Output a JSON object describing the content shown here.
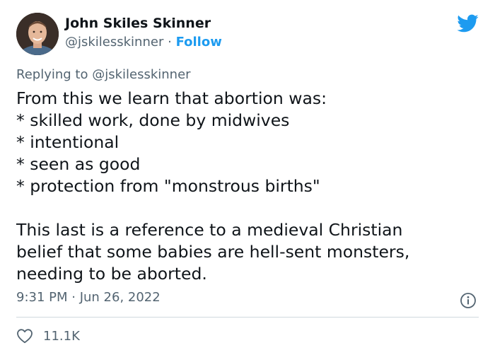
{
  "author": {
    "display_name": "John Skiles Skinner",
    "handle": "@jskilesskinner",
    "separator": "·",
    "follow_label": "Follow"
  },
  "reply": {
    "prefix": "Replying to",
    "handle": "@jskilesskinner"
  },
  "tweet": {
    "lines": [
      "From this we learn that abortion was:",
      "* skilled work, done by midwives",
      "* intentional",
      "* seen as good",
      "* protection from \"monstrous births\""
    ],
    "paragraph2": [
      "This last is a reference to a medieval Christian",
      "belief that some babies are hell-sent monsters,",
      "needing to be aborted."
    ]
  },
  "timestamp": "9:31 PM · Jun 26, 2022",
  "likes": "11.1K",
  "colors": {
    "accent": "#1d9bf0",
    "text": "#0f1419",
    "secondary": "#536471",
    "divider": "#cfd9de"
  },
  "icons": {
    "brand": "twitter-bird-icon",
    "info": "info-icon",
    "like": "heart-outline-icon"
  }
}
